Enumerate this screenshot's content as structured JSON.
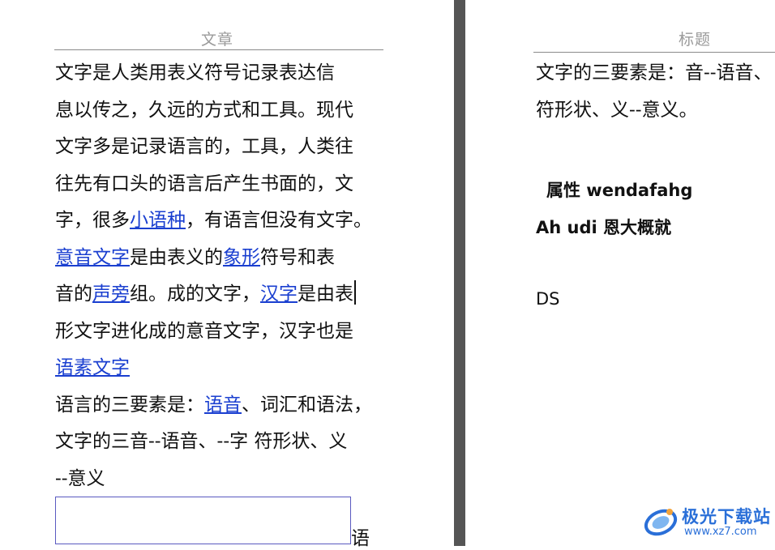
{
  "left_page": {
    "header": "文章",
    "lines": [
      [
        {
          "t": "文字是人类用表义符号记录表达信"
        }
      ],
      [
        {
          "t": "息以传之，久远的方式和工具。现代"
        }
      ],
      [
        {
          "t": "文字多是记录语言的，工具，人类往"
        }
      ],
      [
        {
          "t": "往先有口头的语言后产生书面的，文"
        }
      ],
      [
        {
          "t": "字，很多"
        },
        {
          "t": "小语种",
          "link": true
        },
        {
          "t": "，有语言但没有文字。"
        }
      ],
      [
        {
          "t": "意音文字",
          "link": true
        },
        {
          "t": "是由表义的"
        },
        {
          "t": "象形",
          "link": true
        },
        {
          "t": "符号和表"
        }
      ],
      [
        {
          "t": "音的"
        },
        {
          "t": "声旁",
          "link": true
        },
        {
          "t": "组。成的文字，"
        },
        {
          "t": "汉字",
          "link": true
        },
        {
          "t": "是由表"
        },
        {
          "caret": true
        }
      ],
      [
        {
          "t": "形文字进化成的意音文字，汉字也是"
        }
      ],
      [
        {
          "t": "语素文字",
          "link": true
        }
      ],
      [
        {
          "t": "语言的三要素是："
        },
        {
          "t": "语音",
          "link": true
        },
        {
          "t": "、词汇和语法，"
        }
      ],
      [
        {
          "t": "文字的三音--语音、--字  符形状、义"
        }
      ],
      [
        {
          "t": "--意义"
        }
      ]
    ],
    "after_textbox": "语"
  },
  "right_page": {
    "header": "标题",
    "body_lines": [
      "文字的三要素是：音--语音、",
      "符形状、义--意义。"
    ],
    "attr_line": "属性 wendafahg",
    "ah_line": "Ah udi 恩大概就",
    "ds_line": "DS"
  },
  "watermark": {
    "name": "极光下载站",
    "url": "www.xz7.com"
  },
  "colors": {
    "link": "#1a3fd0",
    "gutter": "#555555",
    "header_text": "#9a9a9a",
    "watermark": "#2a6fd8"
  }
}
